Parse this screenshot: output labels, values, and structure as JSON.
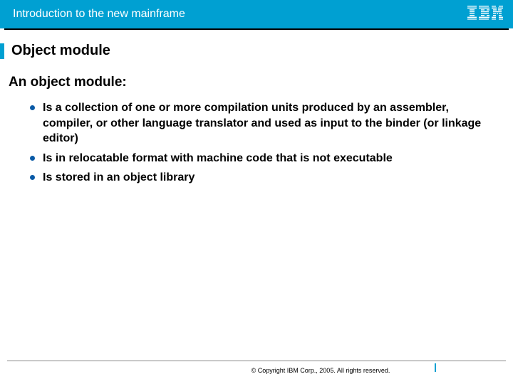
{
  "header": {
    "title": "Introduction to the new mainframe",
    "logo_name": "ibm-logo"
  },
  "slide": {
    "title": "Object module",
    "subtitle": "An object module:",
    "bullets": [
      "Is a collection of one or more compilation units produced by an assembler, compiler, or other language translator and used as input to the binder (or linkage editor)",
      "Is in relocatable format with machine code that is not executable",
      "Is stored in an object library"
    ]
  },
  "footer": {
    "copyright": "© Copyright IBM Corp., 2005. All rights reserved."
  }
}
